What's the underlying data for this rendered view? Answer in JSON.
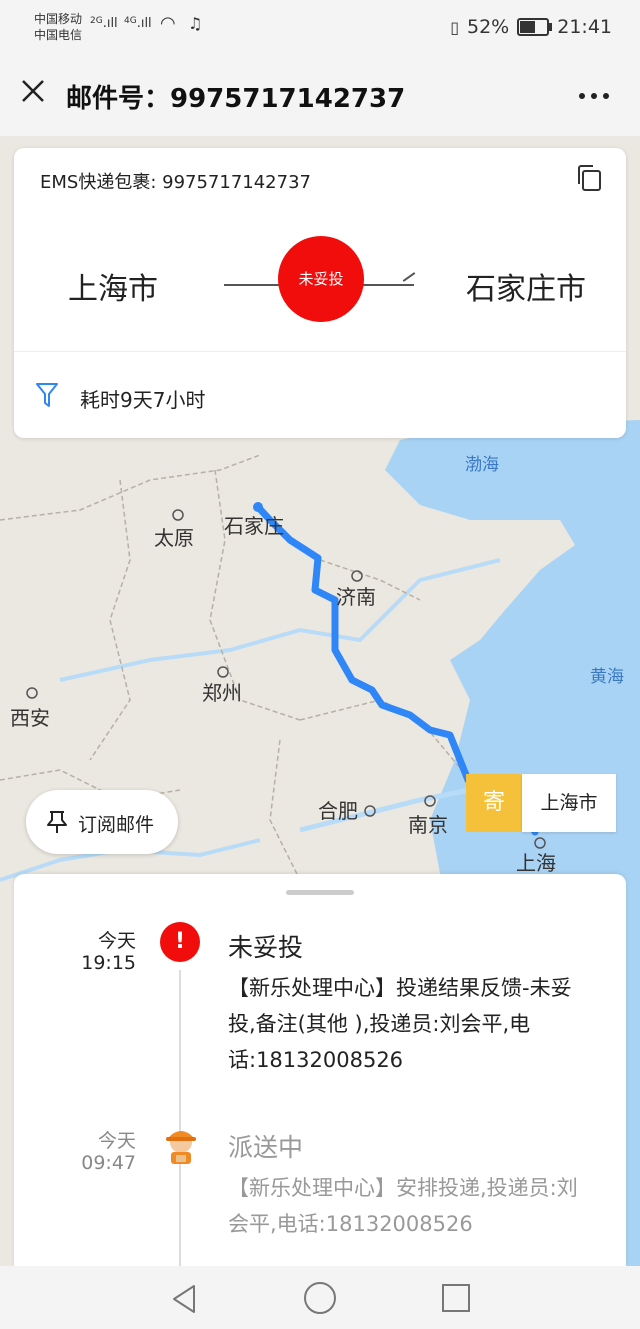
{
  "status_bar": {
    "carrier1": "中国移动",
    "carrier2": "中国电信",
    "net1": "2G",
    "net2": "4G",
    "battery": "52%",
    "time": "21:41"
  },
  "header": {
    "title": "邮件号：9975717142737"
  },
  "summary_card": {
    "package_label": "EMS快递包裹: 9975717142737",
    "from_city": "上海市",
    "to_city": "石家庄市",
    "status_badge": "未妥投",
    "elapsed": "耗时9天7小时"
  },
  "map": {
    "labels": [
      "渤海",
      "黄海",
      "太原",
      "石家庄",
      "济南",
      "郑州",
      "西安",
      "合肥",
      "南京",
      "上海"
    ],
    "origin_tag": "寄",
    "origin_city": "上海市",
    "route_color": "#2f86f6"
  },
  "subscribe": {
    "label": "订阅邮件"
  },
  "timeline": [
    {
      "day": "今天",
      "time": "19:15",
      "status": "未妥投",
      "desc": "【新乐处理中心】投递结果反馈-未妥投,备注(其他 ),投递员:刘会平,电话:18132008526"
    },
    {
      "day": "今天",
      "time": "09:47",
      "status": "派送中",
      "desc": "【新乐处理中心】安排投递,投递员:刘会平,电话:18132008526"
    }
  ],
  "colors": {
    "alert": "#f20d0d",
    "origin_tag": "#f6c13a"
  }
}
